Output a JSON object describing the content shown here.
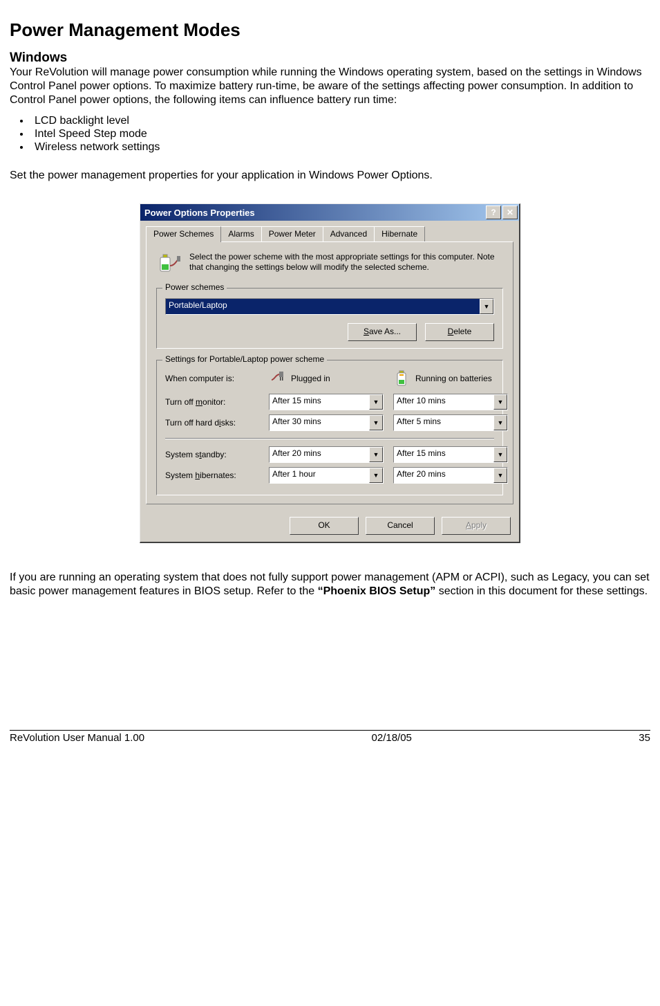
{
  "heading_main": "Power Management Modes",
  "heading_sub": "Windows",
  "para_intro": "Your ReVolution will manage power consumption while running the Windows operating system, based on the settings in Windows Control Panel power options. To maximize battery run-time, be aware of the settings affecting power consumption. In addition to Control Panel power options, the following items can influence battery run time:",
  "bullets": [
    "LCD backlight level",
    "Intel Speed Step mode",
    "Wireless network settings"
  ],
  "para_set": "Set the power management properties for your application in Windows Power Options.",
  "para_after_pre": "If you are running an operating system that does not fully support power management (APM or ACPI), such as Legacy, you can set basic power management features in BIOS setup. Refer to the ",
  "para_after_bold": "“Phoenix BIOS Setup”",
  "para_after_post": " section in this document for these settings.",
  "footer_left": "ReVolution User Manual 1.00",
  "footer_center": "02/18/05",
  "footer_right": "35",
  "dialog": {
    "title": "Power Options Properties",
    "tabs": [
      "Power Schemes",
      "Alarms",
      "Power Meter",
      "Advanced",
      "Hibernate"
    ],
    "info_text": "Select the power scheme with the most appropriate settings for this computer. Note that changing the settings below will modify the selected scheme.",
    "group_schemes_title": "Power schemes",
    "scheme_value": "Portable/Laptop",
    "btn_saveas": "Save As...",
    "btn_delete": "Delete",
    "group_settings_title": "Settings for Portable/Laptop power scheme",
    "col_when": "When computer is:",
    "col_plugged": "Plugged in",
    "col_battery": "Running on batteries",
    "rows": [
      {
        "label": "Turn off monitor:",
        "plugged": "After 15 mins",
        "battery": "After 10 mins"
      },
      {
        "label": "Turn off hard disks:",
        "plugged": "After 30 mins",
        "battery": "After 5 mins"
      },
      {
        "label": "System standby:",
        "plugged": "After 20 mins",
        "battery": "After 15 mins"
      },
      {
        "label": "System hibernates:",
        "plugged": "After 1 hour",
        "battery": "After 20 mins"
      }
    ],
    "btn_ok": "OK",
    "btn_cancel": "Cancel",
    "btn_apply": "Apply"
  }
}
